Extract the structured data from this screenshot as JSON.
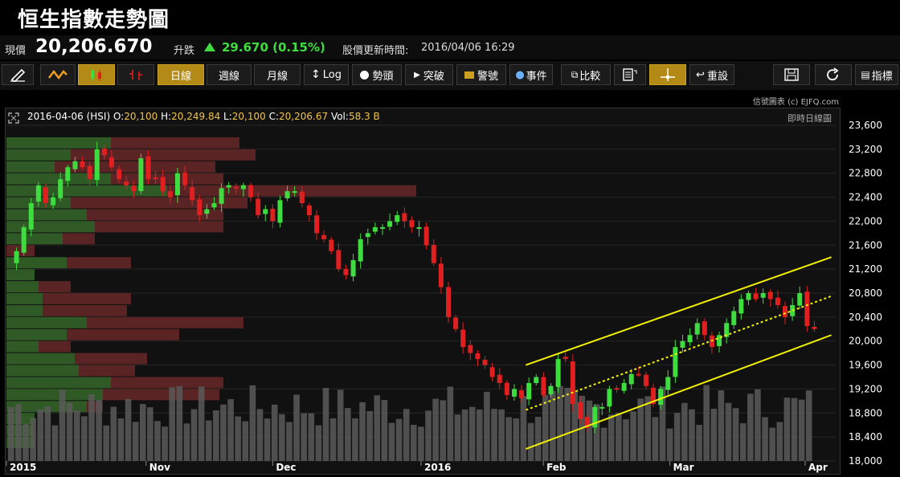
{
  "title": "恒生指數走勢圖",
  "quote": {
    "price_label": "現價",
    "price": "20,206.670",
    "change_label": "升跌",
    "change": "29.670 (0.15%)",
    "update_label": "股價更新時間:",
    "update_time": "2016/04/06 16:29"
  },
  "toolbar": {
    "daily": "日線",
    "weekly": "週線",
    "monthly": "月線",
    "log": "Log",
    "trend": "勢頭",
    "breakout": "突破",
    "alert": "警號",
    "events": "事件",
    "compare": "比較",
    "reset": "重設",
    "index": "指標"
  },
  "credit": "信號圖表 (c) EJFQ.com",
  "ohlc": {
    "date": "2016-04-06",
    "symbol": "(HSI)",
    "o_label": "O:",
    "o": "20,100",
    "h_label": "H:",
    "h": "20,249.84",
    "l_label": "L:",
    "l": "20,100",
    "c_label": "C:",
    "c": "20,206.67",
    "vol_label": "Vol:",
    "vol": "58.3 B"
  },
  "chart_type_label": "即時日線圖",
  "colors": {
    "up": "#3fdc3f",
    "down": "#e02020",
    "accent": "#c9a020",
    "channel": "#f0f000"
  },
  "chart_data": {
    "type": "candlestick",
    "ylim": [
      18000,
      23600
    ],
    "y_ticks": [
      "23,600",
      "23,200",
      "22,800",
      "22,400",
      "22,000",
      "21,600",
      "21,200",
      "20,800",
      "20,400",
      "20,000",
      "19,600",
      "19,200",
      "18,800",
      "18,400",
      "18,000"
    ],
    "x_labels": [
      {
        "label": "2015",
        "date": "2015-10-01"
      },
      {
        "label": "Nov",
        "date": "2015-11-02"
      },
      {
        "label": "Dec",
        "date": "2015-12-01"
      },
      {
        "label": "2016",
        "date": "2016-01-04"
      },
      {
        "label": "Feb",
        "date": "2016-02-01"
      },
      {
        "label": "Mar",
        "date": "2016-03-01"
      },
      {
        "label": "Apr",
        "date": "2016-04-01"
      }
    ],
    "close_series": [
      21500,
      21900,
      22300,
      22600,
      22300,
      22400,
      22700,
      22900,
      23000,
      22900,
      22700,
      23200,
      23100,
      22900,
      22700,
      22600,
      22500,
      23050,
      22700,
      22700,
      22500,
      22400,
      22800,
      22600,
      22350,
      22100,
      22200,
      22300,
      22550,
      22600,
      22550,
      22600,
      22400,
      22100,
      22200,
      22000,
      22350,
      22500,
      22500,
      22300,
      22100,
      21800,
      21700,
      21500,
      21200,
      21100,
      21350,
      21700,
      21800,
      21900,
      21900,
      22000,
      22100,
      22000,
      21900,
      21900,
      21600,
      21300,
      20900,
      20400,
      20200,
      19900,
      19800,
      19700,
      19600,
      19400,
      19300,
      19100,
      19200,
      19050,
      19300,
      19400,
      19100,
      19250,
      19700,
      19700,
      18950,
      18700,
      18550,
      18900,
      18900,
      19200,
      19200,
      19300,
      19450,
      19450,
      19250,
      18950,
      19200,
      19400,
      19900,
      20000,
      20100,
      20300,
      20100,
      19900,
      20100,
      20300,
      20500,
      20700,
      20800,
      20700,
      20800,
      20700,
      20600,
      20400,
      20600,
      20800,
      20250,
      20200
    ],
    "volume_profile": [
      {
        "price_low": 23200,
        "price_high": 23400,
        "up": 130,
        "down": 160
      },
      {
        "price_low": 23000,
        "price_high": 23200,
        "up": 80,
        "down": 230
      },
      {
        "price_low": 22800,
        "price_high": 23000,
        "up": 60,
        "down": 200
      },
      {
        "price_low": 22600,
        "price_high": 22800,
        "up": 130,
        "down": 140
      },
      {
        "price_low": 22400,
        "price_high": 22600,
        "up": 200,
        "down": 310
      },
      {
        "price_low": 22200,
        "price_high": 22400,
        "up": 80,
        "down": 220
      },
      {
        "price_low": 22000,
        "price_high": 22200,
        "up": 100,
        "down": 170
      },
      {
        "price_low": 21800,
        "price_high": 22000,
        "up": 110,
        "down": 160
      },
      {
        "price_low": 21600,
        "price_high": 21800,
        "up": 70,
        "down": 40
      },
      {
        "price_low": 21400,
        "price_high": 21600,
        "up": 0,
        "down": 35
      },
      {
        "price_low": 21200,
        "price_high": 21400,
        "up": 75,
        "down": 80
      },
      {
        "price_low": 21000,
        "price_high": 21200,
        "up": 35,
        "down": 0
      },
      {
        "price_low": 20800,
        "price_high": 21000,
        "up": 40,
        "down": 40
      },
      {
        "price_low": 20600,
        "price_high": 20800,
        "up": 45,
        "down": 110
      },
      {
        "price_low": 20400,
        "price_high": 20600,
        "up": 45,
        "down": 105
      },
      {
        "price_low": 20200,
        "price_high": 20400,
        "up": 100,
        "down": 195
      },
      {
        "price_low": 20000,
        "price_high": 20200,
        "up": 75,
        "down": 140
      },
      {
        "price_low": 19800,
        "price_high": 20000,
        "up": 40,
        "down": 40
      },
      {
        "price_low": 19600,
        "price_high": 19800,
        "up": 85,
        "down": 90
      },
      {
        "price_low": 19400,
        "price_high": 19600,
        "up": 90,
        "down": 70
      },
      {
        "price_low": 19200,
        "price_high": 19400,
        "up": 130,
        "down": 140
      },
      {
        "price_low": 19000,
        "price_high": 19200,
        "up": 120,
        "down": 145
      },
      {
        "price_low": 18800,
        "price_high": 19000,
        "up": 100,
        "down": 20
      },
      {
        "price_low": 18600,
        "price_high": 18800,
        "up": 35,
        "down": 0
      },
      {
        "price_low": 18400,
        "price_high": 18600,
        "up": 35,
        "down": 0
      },
      {
        "price_low": 18200,
        "price_high": 18400,
        "up": 35,
        "down": 0
      }
    ],
    "channel": {
      "upper": [
        {
          "date": "2016-01-28",
          "value": 19600
        },
        {
          "date": "2016-04-07",
          "value": 21400
        }
      ],
      "middle": [
        {
          "date": "2016-01-28",
          "value": 18850
        },
        {
          "date": "2016-04-07",
          "value": 20750
        }
      ],
      "lower": [
        {
          "date": "2016-01-28",
          "value": 18200
        },
        {
          "date": "2016-04-07",
          "value": 20100
        }
      ]
    }
  }
}
